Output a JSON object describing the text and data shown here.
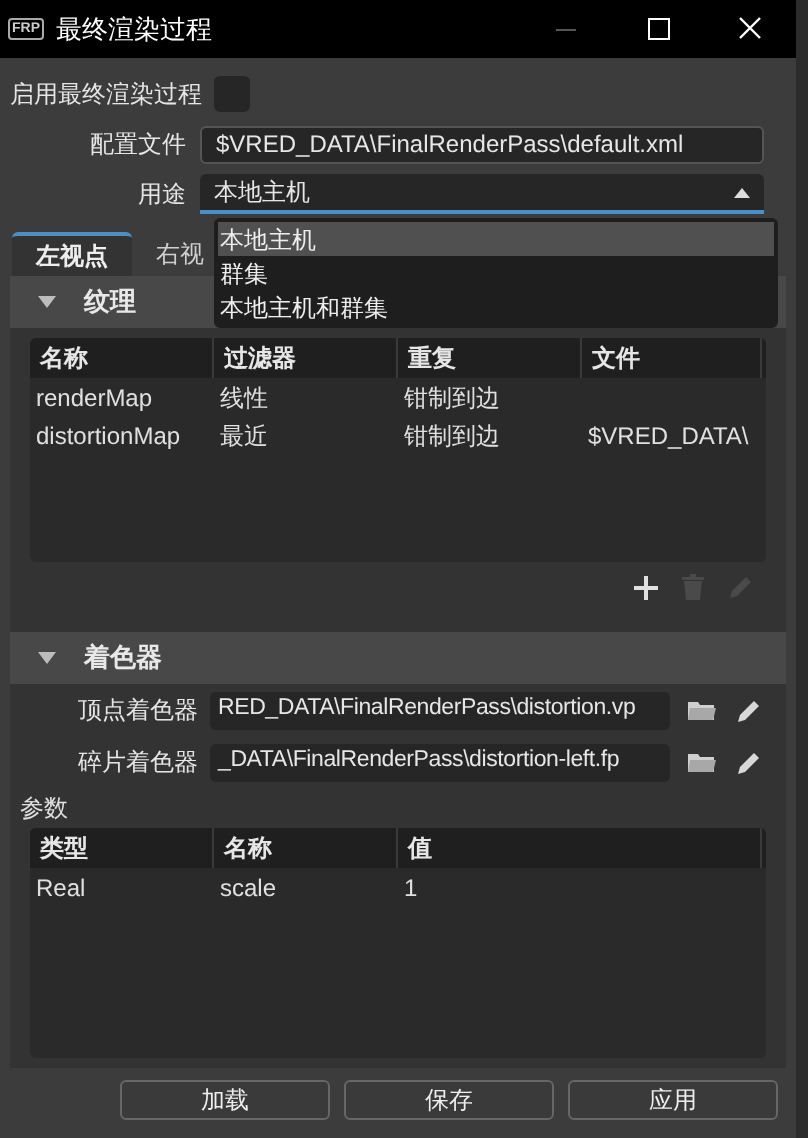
{
  "window": {
    "title": "最终渲染过程",
    "logo": "FRP"
  },
  "enable": {
    "label": "启用最终渲染过程",
    "checked": false
  },
  "config_file": {
    "label": "配置文件",
    "value": "$VRED_DATA\\FinalRenderPass\\default.xml"
  },
  "purpose": {
    "label": "用途",
    "value": "本地主机",
    "expanded": true,
    "options": [
      {
        "label": "本地主机",
        "selected": true
      },
      {
        "label": "群集",
        "selected": false
      },
      {
        "label": "本地主机和群集",
        "selected": false
      }
    ]
  },
  "tabs": [
    {
      "label": "左视点",
      "selected": true
    },
    {
      "label": "右视",
      "selected": false
    }
  ],
  "textures": {
    "title": "纹理",
    "expanded": true,
    "columns": [
      "名称",
      "过滤器",
      "重复",
      "文件"
    ],
    "rows": [
      [
        "renderMap",
        "线性",
        "钳制到边",
        ""
      ],
      [
        "distortionMap",
        "最近",
        "钳制到边",
        "$VRED_DATA\\"
      ]
    ],
    "actions": [
      {
        "kind": "add",
        "disabled": false
      },
      {
        "kind": "delete",
        "disabled": true
      },
      {
        "kind": "edit",
        "disabled": true
      }
    ]
  },
  "shaders": {
    "title": "着色器",
    "expanded": true,
    "fields": [
      {
        "label": "顶点着色器",
        "value": "RED_DATA\\FinalRenderPass\\distortion.vp"
      },
      {
        "label": "碎片着色器",
        "value": "_DATA\\FinalRenderPass\\distortion-left.fp"
      }
    ]
  },
  "parameters": {
    "label": "参数",
    "columns": [
      "类型",
      "名称",
      "值"
    ],
    "rows": [
      [
        "Real",
        "scale",
        "1"
      ]
    ]
  },
  "buttons": [
    "加载",
    "保存",
    "应用"
  ]
}
